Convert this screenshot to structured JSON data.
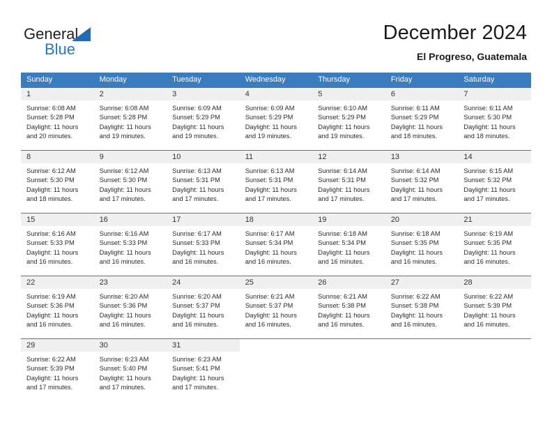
{
  "brand": {
    "name_top": "General",
    "name_bottom": "Blue",
    "triangle_icon": "triangle-icon",
    "color_dark": "#231f20",
    "color_blue": "#2079c3"
  },
  "header": {
    "title": "December 2024",
    "subtitle": "El Progreso, Guatemala"
  },
  "theme": {
    "header_bg": "#3a7cbe",
    "header_text": "#ffffff",
    "daynum_bg": "#f0f0f0",
    "body_text": "#2b2b2b"
  },
  "calendar": {
    "weekday_headers": [
      "Sunday",
      "Monday",
      "Tuesday",
      "Wednesday",
      "Thursday",
      "Friday",
      "Saturday"
    ],
    "weeks": [
      [
        {
          "day": "1",
          "sunrise": "Sunrise: 6:08 AM",
          "sunset": "Sunset: 5:28 PM",
          "daylight1": "Daylight: 11 hours",
          "daylight2": "and 20 minutes."
        },
        {
          "day": "2",
          "sunrise": "Sunrise: 6:08 AM",
          "sunset": "Sunset: 5:28 PM",
          "daylight1": "Daylight: 11 hours",
          "daylight2": "and 19 minutes."
        },
        {
          "day": "3",
          "sunrise": "Sunrise: 6:09 AM",
          "sunset": "Sunset: 5:29 PM",
          "daylight1": "Daylight: 11 hours",
          "daylight2": "and 19 minutes."
        },
        {
          "day": "4",
          "sunrise": "Sunrise: 6:09 AM",
          "sunset": "Sunset: 5:29 PM",
          "daylight1": "Daylight: 11 hours",
          "daylight2": "and 19 minutes."
        },
        {
          "day": "5",
          "sunrise": "Sunrise: 6:10 AM",
          "sunset": "Sunset: 5:29 PM",
          "daylight1": "Daylight: 11 hours",
          "daylight2": "and 19 minutes."
        },
        {
          "day": "6",
          "sunrise": "Sunrise: 6:11 AM",
          "sunset": "Sunset: 5:29 PM",
          "daylight1": "Daylight: 11 hours",
          "daylight2": "and 18 minutes."
        },
        {
          "day": "7",
          "sunrise": "Sunrise: 6:11 AM",
          "sunset": "Sunset: 5:30 PM",
          "daylight1": "Daylight: 11 hours",
          "daylight2": "and 18 minutes."
        }
      ],
      [
        {
          "day": "8",
          "sunrise": "Sunrise: 6:12 AM",
          "sunset": "Sunset: 5:30 PM",
          "daylight1": "Daylight: 11 hours",
          "daylight2": "and 18 minutes."
        },
        {
          "day": "9",
          "sunrise": "Sunrise: 6:12 AM",
          "sunset": "Sunset: 5:30 PM",
          "daylight1": "Daylight: 11 hours",
          "daylight2": "and 17 minutes."
        },
        {
          "day": "10",
          "sunrise": "Sunrise: 6:13 AM",
          "sunset": "Sunset: 5:31 PM",
          "daylight1": "Daylight: 11 hours",
          "daylight2": "and 17 minutes."
        },
        {
          "day": "11",
          "sunrise": "Sunrise: 6:13 AM",
          "sunset": "Sunset: 5:31 PM",
          "daylight1": "Daylight: 11 hours",
          "daylight2": "and 17 minutes."
        },
        {
          "day": "12",
          "sunrise": "Sunrise: 6:14 AM",
          "sunset": "Sunset: 5:31 PM",
          "daylight1": "Daylight: 11 hours",
          "daylight2": "and 17 minutes."
        },
        {
          "day": "13",
          "sunrise": "Sunrise: 6:14 AM",
          "sunset": "Sunset: 5:32 PM",
          "daylight1": "Daylight: 11 hours",
          "daylight2": "and 17 minutes."
        },
        {
          "day": "14",
          "sunrise": "Sunrise: 6:15 AM",
          "sunset": "Sunset: 5:32 PM",
          "daylight1": "Daylight: 11 hours",
          "daylight2": "and 17 minutes."
        }
      ],
      [
        {
          "day": "15",
          "sunrise": "Sunrise: 6:16 AM",
          "sunset": "Sunset: 5:33 PM",
          "daylight1": "Daylight: 11 hours",
          "daylight2": "and 16 minutes."
        },
        {
          "day": "16",
          "sunrise": "Sunrise: 6:16 AM",
          "sunset": "Sunset: 5:33 PM",
          "daylight1": "Daylight: 11 hours",
          "daylight2": "and 16 minutes."
        },
        {
          "day": "17",
          "sunrise": "Sunrise: 6:17 AM",
          "sunset": "Sunset: 5:33 PM",
          "daylight1": "Daylight: 11 hours",
          "daylight2": "and 16 minutes."
        },
        {
          "day": "18",
          "sunrise": "Sunrise: 6:17 AM",
          "sunset": "Sunset: 5:34 PM",
          "daylight1": "Daylight: 11 hours",
          "daylight2": "and 16 minutes."
        },
        {
          "day": "19",
          "sunrise": "Sunrise: 6:18 AM",
          "sunset": "Sunset: 5:34 PM",
          "daylight1": "Daylight: 11 hours",
          "daylight2": "and 16 minutes."
        },
        {
          "day": "20",
          "sunrise": "Sunrise: 6:18 AM",
          "sunset": "Sunset: 5:35 PM",
          "daylight1": "Daylight: 11 hours",
          "daylight2": "and 16 minutes."
        },
        {
          "day": "21",
          "sunrise": "Sunrise: 6:19 AM",
          "sunset": "Sunset: 5:35 PM",
          "daylight1": "Daylight: 11 hours",
          "daylight2": "and 16 minutes."
        }
      ],
      [
        {
          "day": "22",
          "sunrise": "Sunrise: 6:19 AM",
          "sunset": "Sunset: 5:36 PM",
          "daylight1": "Daylight: 11 hours",
          "daylight2": "and 16 minutes."
        },
        {
          "day": "23",
          "sunrise": "Sunrise: 6:20 AM",
          "sunset": "Sunset: 5:36 PM",
          "daylight1": "Daylight: 11 hours",
          "daylight2": "and 16 minutes."
        },
        {
          "day": "24",
          "sunrise": "Sunrise: 6:20 AM",
          "sunset": "Sunset: 5:37 PM",
          "daylight1": "Daylight: 11 hours",
          "daylight2": "and 16 minutes."
        },
        {
          "day": "25",
          "sunrise": "Sunrise: 6:21 AM",
          "sunset": "Sunset: 5:37 PM",
          "daylight1": "Daylight: 11 hours",
          "daylight2": "and 16 minutes."
        },
        {
          "day": "26",
          "sunrise": "Sunrise: 6:21 AM",
          "sunset": "Sunset: 5:38 PM",
          "daylight1": "Daylight: 11 hours",
          "daylight2": "and 16 minutes."
        },
        {
          "day": "27",
          "sunrise": "Sunrise: 6:22 AM",
          "sunset": "Sunset: 5:38 PM",
          "daylight1": "Daylight: 11 hours",
          "daylight2": "and 16 minutes."
        },
        {
          "day": "28",
          "sunrise": "Sunrise: 6:22 AM",
          "sunset": "Sunset: 5:39 PM",
          "daylight1": "Daylight: 11 hours",
          "daylight2": "and 16 minutes."
        }
      ],
      [
        {
          "day": "29",
          "sunrise": "Sunrise: 6:22 AM",
          "sunset": "Sunset: 5:39 PM",
          "daylight1": "Daylight: 11 hours",
          "daylight2": "and 17 minutes."
        },
        {
          "day": "30",
          "sunrise": "Sunrise: 6:23 AM",
          "sunset": "Sunset: 5:40 PM",
          "daylight1": "Daylight: 11 hours",
          "daylight2": "and 17 minutes."
        },
        {
          "day": "31",
          "sunrise": "Sunrise: 6:23 AM",
          "sunset": "Sunset: 5:41 PM",
          "daylight1": "Daylight: 11 hours",
          "daylight2": "and 17 minutes."
        },
        {
          "day": "",
          "sunrise": "",
          "sunset": "",
          "daylight1": "",
          "daylight2": ""
        },
        {
          "day": "",
          "sunrise": "",
          "sunset": "",
          "daylight1": "",
          "daylight2": ""
        },
        {
          "day": "",
          "sunrise": "",
          "sunset": "",
          "daylight1": "",
          "daylight2": ""
        },
        {
          "day": "",
          "sunrise": "",
          "sunset": "",
          "daylight1": "",
          "daylight2": ""
        }
      ]
    ]
  }
}
